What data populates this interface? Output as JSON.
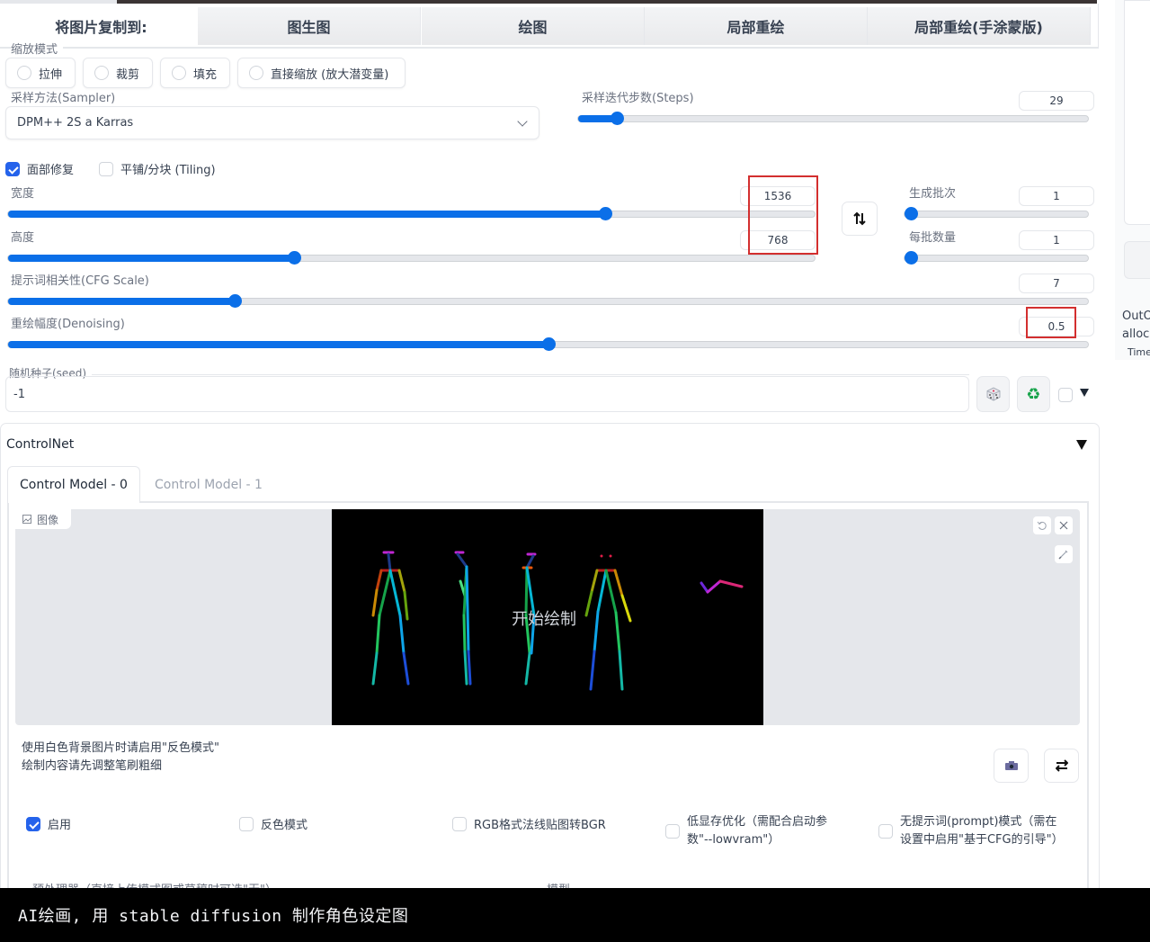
{
  "copy_to": {
    "label": "将图片复制到:",
    "buttons": [
      "图生图",
      "绘图",
      "局部重绘",
      "局部重绘(手涂蒙版)"
    ]
  },
  "resize_mode": {
    "label": "缩放模式",
    "options": [
      "拉伸",
      "裁剪",
      "填充",
      "直接缩放 (放大潜变量)"
    ]
  },
  "sampler": {
    "label": "采样方法(Sampler)",
    "value": "DPM++ 2S a Karras"
  },
  "steps": {
    "label": "采样迭代步数(Steps)",
    "value": "29",
    "fraction": 0.075
  },
  "checks": {
    "face_restore": {
      "label": "面部修复",
      "checked": true
    },
    "tiling": {
      "label": "平铺/分块 (Tiling)",
      "checked": false
    }
  },
  "width": {
    "label": "宽度",
    "value": "1536",
    "fraction": 0.74
  },
  "height": {
    "label": "高度",
    "value": "768",
    "fraction": 0.355
  },
  "swap_icon": "swap-vertical-icon",
  "batch_count": {
    "label": "生成批次",
    "value": "1",
    "fraction": 0.0
  },
  "batch_size": {
    "label": "每批数量",
    "value": "1",
    "fraction": 0.0
  },
  "cfg": {
    "label": "提示词相关性(CFG Scale)",
    "value": "7",
    "fraction": 0.21
  },
  "denoising": {
    "label": "重绘幅度(Denoising)",
    "value": "0.5",
    "fraction": 0.5
  },
  "seed": {
    "label": "随机种子(seed)",
    "value": "-1"
  },
  "seed_buttons": {
    "dice": "dice-icon",
    "recycle": "recycle-icon"
  },
  "controlnet": {
    "title": "ControlNet",
    "tabs": [
      "Control Model - 0",
      "Control Model - 1"
    ],
    "image_label": "图像",
    "canvas_overlay": "开始绘制",
    "hint_lines": [
      "使用白色背景图片时请启用\"反色模式\"",
      "绘制内容请先调整笔刷粗细"
    ],
    "options": [
      {
        "label": "启用",
        "checked": true
      },
      {
        "label": "反色模式",
        "checked": false
      },
      {
        "label": "RGB格式法线贴图转BGR",
        "checked": false
      },
      {
        "label": "低显存优化（需配合启动参数\"--lowvram\"）",
        "checked": false
      },
      {
        "label": "无提示词(prompt)模式（需在设置中启用\"基于CFG的引导\"）",
        "checked": false
      }
    ],
    "cut_row": [
      "预处理器（直接上传模式图或草稿时可选\"无\"）",
      "模型"
    ]
  },
  "side_panel": {
    "lines": [
      "OutO",
      "alloca",
      "Time"
    ]
  },
  "caption": "AI绘画, 用 stable diffusion 制作角色设定图",
  "colors": {
    "accent": "#0b6fe8",
    "highlight": "#d32f2f"
  }
}
